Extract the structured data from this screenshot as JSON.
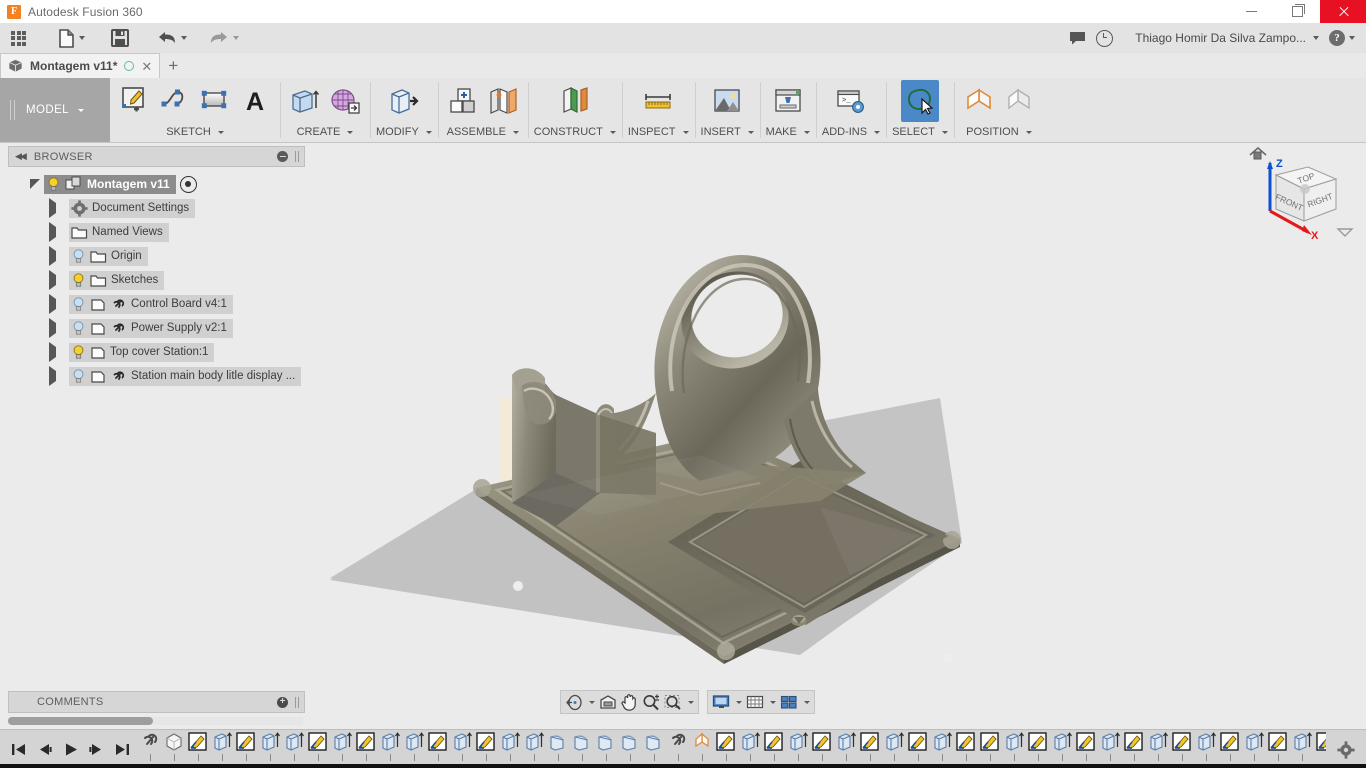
{
  "window": {
    "title": "Autodesk Fusion 360",
    "app_icon": "fusion-logo-icon",
    "minimize_label": "Minimize",
    "maximize_label": "Restore",
    "close_label": "Close",
    "close_color": "#e81123"
  },
  "quick_access": {
    "items": [
      {
        "name": "app-grid",
        "icon": "grid-apps-icon",
        "has_caret": false
      },
      {
        "name": "file",
        "icon": "file-icon",
        "has_caret": true
      },
      {
        "name": "save",
        "icon": "save-disk-icon",
        "has_caret": false
      },
      {
        "name": "undo",
        "icon": "undo-arrow-icon",
        "has_caret": true
      },
      {
        "name": "redo",
        "icon": "redo-arrow-icon",
        "has_caret": true
      }
    ],
    "right": {
      "comments_icon": "speech-bubble-icon",
      "history_icon": "clock-icon",
      "user_name": "Thiago Homir Da Silva Zampo...",
      "help_label": "?"
    }
  },
  "tabs": {
    "documents": [
      {
        "icon": "cube-icon",
        "label": "Montagem v11*",
        "modified": true,
        "close_label": "✕"
      }
    ],
    "new_tab_label": "+"
  },
  "ribbon": {
    "workspace": {
      "label": "MODEL",
      "has_caret": true
    },
    "panels": [
      {
        "label": "SKETCH",
        "has_caret": true,
        "buttons": [
          {
            "name": "create-sketch",
            "icon": "new-sketch-icon"
          },
          {
            "name": "sketch-spline",
            "icon": "spline-curve-icon"
          },
          {
            "name": "sketch-rectangle",
            "icon": "rectangle-icon"
          },
          {
            "name": "sketch-text",
            "icon": "text-a-icon"
          }
        ]
      },
      {
        "label": "CREATE",
        "has_caret": true,
        "buttons": [
          {
            "name": "extrude",
            "icon": "extrude-icon"
          },
          {
            "name": "create-form",
            "icon": "form-mesh-icon"
          }
        ]
      },
      {
        "label": "MODIFY",
        "has_caret": true,
        "buttons": [
          {
            "name": "press-pull",
            "icon": "press-pull-icon"
          }
        ]
      },
      {
        "label": "ASSEMBLE",
        "has_caret": true,
        "buttons": [
          {
            "name": "new-component",
            "icon": "new-component-icon"
          },
          {
            "name": "joint",
            "icon": "joint-icon"
          }
        ]
      },
      {
        "label": "CONSTRUCT",
        "has_caret": true,
        "buttons": [
          {
            "name": "offset-plane",
            "icon": "construction-plane-icon"
          }
        ]
      },
      {
        "label": "INSPECT",
        "has_caret": true,
        "buttons": [
          {
            "name": "measure",
            "icon": "ruler-icon"
          }
        ]
      },
      {
        "label": "INSERT",
        "has_caret": true,
        "buttons": [
          {
            "name": "insert-canvas",
            "icon": "picture-icon"
          }
        ]
      },
      {
        "label": "MAKE",
        "has_caret": true,
        "buttons": [
          {
            "name": "3d-print",
            "icon": "3d-printer-icon"
          }
        ]
      },
      {
        "label": "ADD-INS",
        "has_caret": true,
        "buttons": [
          {
            "name": "scripts-and-addins",
            "icon": "console-gear-icon"
          }
        ]
      },
      {
        "label": "SELECT",
        "has_caret": true,
        "active": true,
        "buttons": [
          {
            "name": "select",
            "icon": "lasso-cursor-icon",
            "active": true
          }
        ]
      },
      {
        "label": "POSITION",
        "has_caret": true,
        "buttons": [
          {
            "name": "move-copy",
            "icon": "move-copy-icon"
          },
          {
            "name": "align",
            "icon": "align-icon"
          }
        ]
      }
    ]
  },
  "browser": {
    "title": "BROWSER",
    "collapse_icon": "double-chevron-left-icon",
    "minimize_icon": "minus-circle-icon",
    "tree": [
      {
        "label": "Montagem v11",
        "level": 0,
        "expanded": true,
        "root": true,
        "bulb": "on",
        "icon": "assembly-icon",
        "has_target": true
      },
      {
        "label": "Document Settings",
        "level": 1,
        "expanded": false,
        "bulb": "none",
        "icon": "gear-icon"
      },
      {
        "label": "Named Views",
        "level": 1,
        "expanded": false,
        "bulb": "none",
        "icon": "folder-icon"
      },
      {
        "label": "Origin",
        "level": 1,
        "expanded": false,
        "bulb": "off",
        "icon": "folder-icon"
      },
      {
        "label": "Sketches",
        "level": 1,
        "expanded": false,
        "bulb": "on",
        "icon": "folder-icon"
      },
      {
        "label": "Control Board v4:1",
        "level": 1,
        "expanded": false,
        "bulb": "off",
        "icon": "component-icon",
        "linked": true
      },
      {
        "label": "Power Supply v2:1",
        "level": 1,
        "expanded": false,
        "bulb": "off",
        "icon": "component-icon",
        "linked": true
      },
      {
        "label": "Top cover Station:1",
        "level": 1,
        "expanded": false,
        "bulb": "on",
        "icon": "component-icon",
        "linked": false
      },
      {
        "label": "Station main body litle display ...",
        "level": 1,
        "expanded": false,
        "bulb": "off",
        "icon": "component-icon",
        "linked": true
      }
    ]
  },
  "comments": {
    "title": "COMMENTS",
    "add_label": "+"
  },
  "viewcube": {
    "faces": {
      "top": "TOP",
      "front": "FRONT",
      "right": "RIGHT"
    },
    "axes": {
      "z": "Z",
      "x": "X"
    },
    "home_icon": "home-icon",
    "dropdown_icon": "viewcube-menu-icon",
    "axis_colors": {
      "z": "#0b4fd4",
      "x": "#e31a1a"
    }
  },
  "canvas": {
    "background": "#ebebeb",
    "model_name": "station-main-body-3d-model",
    "material_color": "#8c8878",
    "shadow_color": "#c3c3c3",
    "backdrop_color": "#f1e8d8"
  },
  "navbar": {
    "group1": [
      {
        "name": "orbit",
        "icon": "orbit-icon",
        "has_caret": true
      },
      {
        "name": "look-at",
        "icon": "look-at-icon",
        "has_caret": false
      },
      {
        "name": "pan",
        "icon": "hand-pan-icon",
        "has_caret": false
      },
      {
        "name": "zoom",
        "icon": "magnifier-plusminus-icon",
        "has_caret": false
      },
      {
        "name": "fit",
        "icon": "zoom-fit-icon",
        "has_caret": true
      }
    ],
    "group2": [
      {
        "name": "display-settings",
        "icon": "monitor-icon",
        "has_caret": true
      },
      {
        "name": "grid-and-snaps",
        "icon": "grid-icon",
        "has_caret": true
      },
      {
        "name": "viewports",
        "icon": "viewports-icon",
        "has_caret": true
      }
    ]
  },
  "timeline": {
    "playback": [
      {
        "name": "go-to-beginning",
        "icon": "skip-back-icon"
      },
      {
        "name": "step-back",
        "icon": "step-back-icon"
      },
      {
        "name": "play",
        "icon": "play-icon"
      },
      {
        "name": "step-forward",
        "icon": "step-forward-icon"
      },
      {
        "name": "go-to-end",
        "icon": "skip-forward-icon"
      }
    ],
    "settings_icon": "gear-icon",
    "features": [
      "link-icon",
      "body-icon",
      "sketch-icon",
      "extrude-icon",
      "sketch-icon",
      "extrude-icon",
      "extrude-icon",
      "sketch-icon",
      "extrude-icon",
      "sketch-icon",
      "extrude-icon",
      "extrude-icon",
      "sketch-icon",
      "extrude-icon",
      "sketch-icon",
      "extrude-icon",
      "extrude-icon",
      "fillet-icon",
      "fillet-icon",
      "fillet-icon",
      "fillet-icon",
      "fillet-icon",
      "link-icon",
      "move-icon",
      "sketch-icon",
      "extrude-icon",
      "sketch-icon",
      "extrude-icon",
      "sketch-icon",
      "extrude-icon",
      "sketch-icon",
      "extrude-icon",
      "sketch-icon",
      "extrude-icon",
      "sketch-icon",
      "sketch-icon",
      "extrude-icon",
      "sketch-icon",
      "extrude-icon",
      "sketch-icon",
      "extrude-icon",
      "sketch-icon",
      "extrude-icon",
      "sketch-icon",
      "extrude-icon",
      "sketch-icon",
      "extrude-icon",
      "sketch-icon",
      "extrude-icon",
      "sketch-icon",
      "extrude-icon",
      "sketch-icon",
      "extrude-icon",
      "sketch-icon"
    ]
  }
}
